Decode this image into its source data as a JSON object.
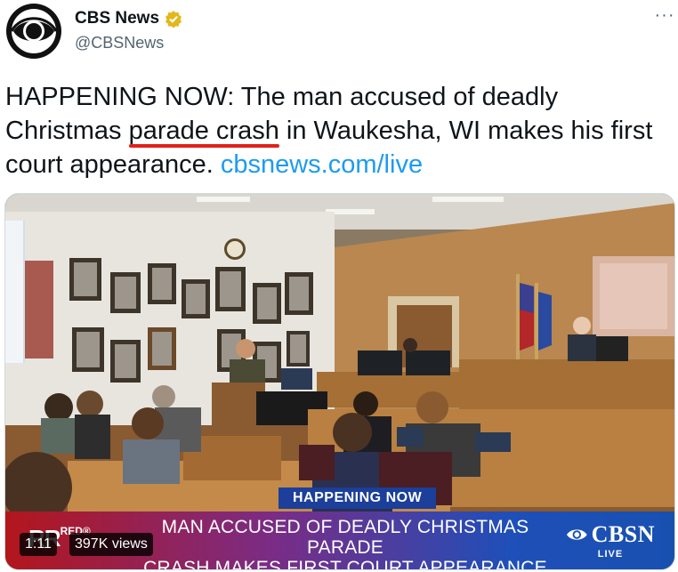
{
  "account": {
    "display_name": "CBS News",
    "handle": "@CBSNews",
    "verified_icon": "verified-badge-gold",
    "avatar_icon": "cbs-eye-logo",
    "more_icon": "more-dots-icon",
    "more_label": "···"
  },
  "tweet": {
    "text_before": "HAPPENING NOW: The man accused of deadly Christmas ",
    "highlight": "parade crash",
    "text_after": " in Waukesha, WI makes his first court appearance. ",
    "link": "cbsnews.com/live",
    "link_color": "#1d9bf0",
    "highlight_color": "#e0211b"
  },
  "video": {
    "tag": "HAPPENING NOW",
    "banner_line1": "MAN ACCUSED OF DEADLY CHRISTMAS PARADE",
    "banner_line2_highlight": "CRASH",
    "banner_line2_rest": " MAKES FIRST COURT APPEARANCE",
    "brand_left": "RR",
    "brand_left_small": "RED®",
    "network": "CBSN",
    "network_live": "LIVE",
    "elapsed": "1:11",
    "views": "397K views"
  }
}
